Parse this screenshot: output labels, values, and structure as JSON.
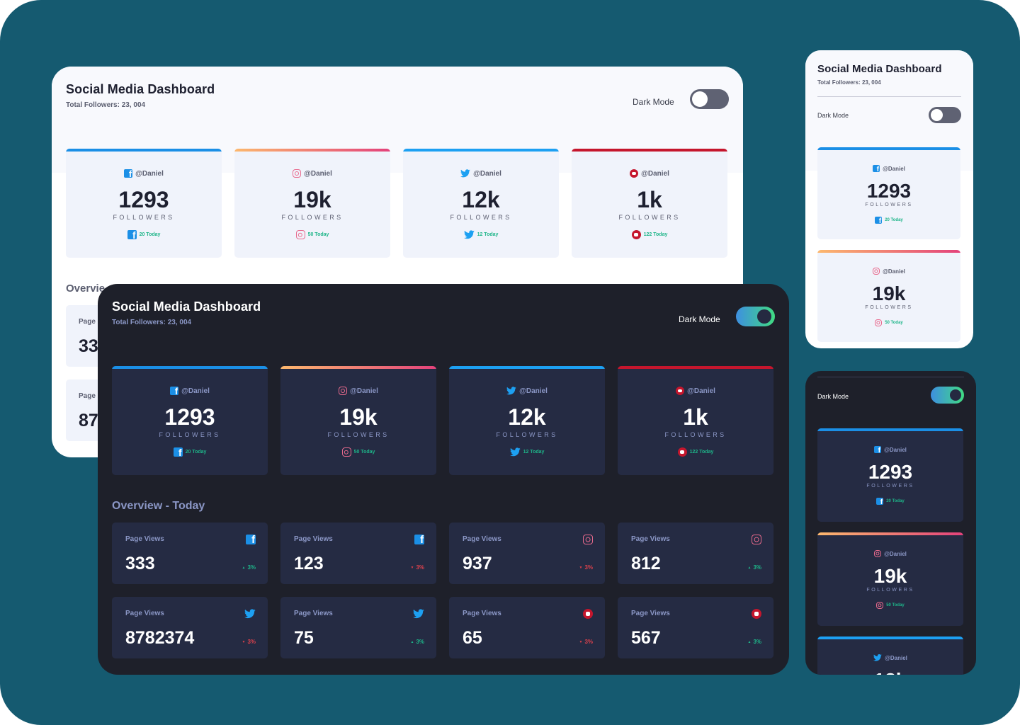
{
  "dashboard": {
    "title": "Social Media Dashboard",
    "total_followers": "Total Followers: 23, 004",
    "dark_mode_label": "Dark Mode",
    "overview_heading": "Overview - Today",
    "overview_partial": "Overvie",
    "light_partial_labels": [
      "Page",
      "Page"
    ],
    "light_partial_values": [
      "33",
      "87"
    ]
  },
  "followers": [
    {
      "platform": "facebook",
      "handle": "@Daniel",
      "count": "1293",
      "label": "FOLLOWERS",
      "today": "20 Today"
    },
    {
      "platform": "instagram",
      "handle": "@Daniel",
      "count": "19k",
      "label": "FOLLOWERS",
      "today": "50 Today"
    },
    {
      "platform": "twitter",
      "handle": "@Daniel",
      "count": "12k",
      "label": "FOLLOWERS",
      "today": "12 Today"
    },
    {
      "platform": "youtube",
      "handle": "@Daniel",
      "count": "1k",
      "label": "FOLLOWERS",
      "today": "122 Today"
    }
  ],
  "overview": [
    {
      "label": "Page Views",
      "platform": "facebook",
      "value": "333",
      "change": "3%",
      "trend": "up"
    },
    {
      "label": "Page Views",
      "platform": "facebook",
      "value": "123",
      "change": "3%",
      "trend": "down"
    },
    {
      "label": "Page Views",
      "platform": "instagram",
      "value": "937",
      "change": "3%",
      "trend": "down"
    },
    {
      "label": "Page Views",
      "platform": "instagram",
      "value": "812",
      "change": "3%",
      "trend": "up"
    },
    {
      "label": "Page Views",
      "platform": "twitter",
      "value": "8782374",
      "change": "3%",
      "trend": "down"
    },
    {
      "label": "Page Views",
      "platform": "twitter",
      "value": "75",
      "change": "3%",
      "trend": "up"
    },
    {
      "label": "Page Views",
      "platform": "youtube",
      "value": "65",
      "change": "3%",
      "trend": "down"
    },
    {
      "label": "Page Views",
      "platform": "youtube",
      "value": "567",
      "change": "3%",
      "trend": "up"
    }
  ],
  "arrows": {
    "up": "▲",
    "down": "▼"
  },
  "icons": {
    "facebook": "facebook-icon",
    "instagram": "instagram-icon",
    "twitter": "twitter-icon",
    "youtube": "youtube-icon"
  },
  "colors": {
    "background": "#155a70",
    "dark_panel": "#1e202a",
    "dark_card": "#252b43",
    "light_card": "#f0f3fb",
    "facebook": "#1b8fe6",
    "twitter": "#1da0f2",
    "youtube": "#c5162d",
    "instagram_start": "#fcb86e",
    "instagram_end": "#e3427b",
    "up": "#1eb589",
    "down": "#dc414c",
    "toggle_on_start": "#3e8fe0",
    "toggle_on_end": "#40db82"
  },
  "toggles": {
    "light_state": "off",
    "dark_state": "on"
  }
}
